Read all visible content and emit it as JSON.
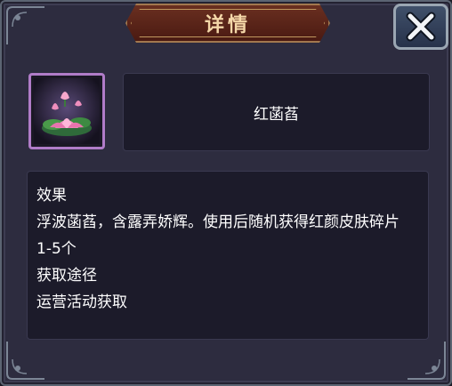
{
  "header": {
    "title": "详情"
  },
  "close_button": {
    "icon": "close-icon"
  },
  "item": {
    "icon": "pink-lotus-icon",
    "name": "红菡萏"
  },
  "description": {
    "effect_heading": "效果",
    "effect_text": "浮波菡萏，含露弄娇辉。使用后随机获得红颜皮肤碎片1-5个",
    "source_heading": "获取途径",
    "source_text": "运营活动获取"
  },
  "colors": {
    "panel_bg": "#2d2c3f",
    "title_plate": "#5a241a",
    "title_text": "#f4d7a8",
    "item_border": "#b07cc8",
    "text": "#ffffff"
  }
}
